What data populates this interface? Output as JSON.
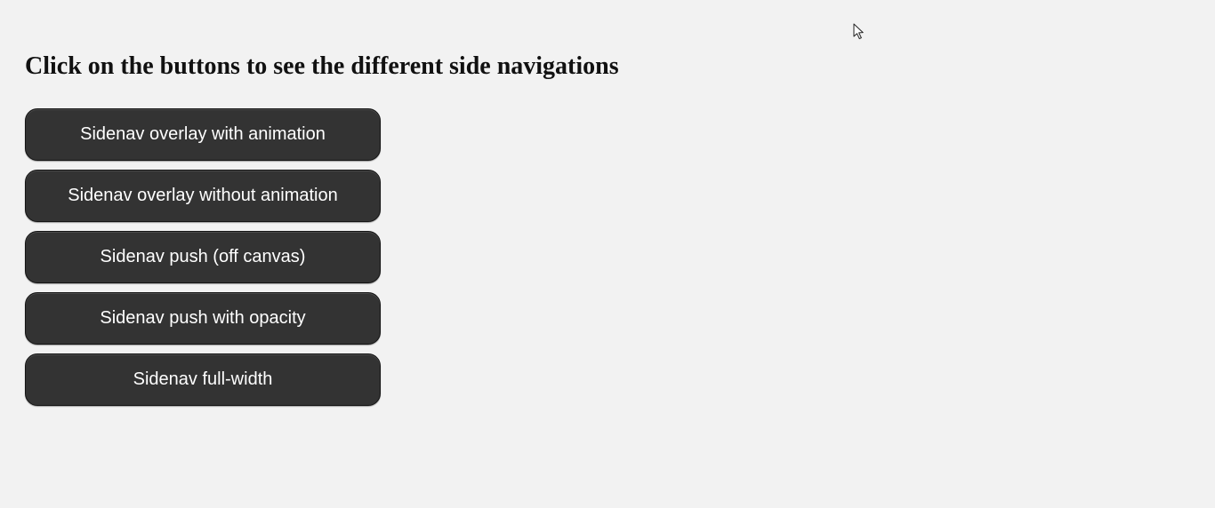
{
  "page": {
    "title": "Click on the buttons to see the different side navigations"
  },
  "buttons": [
    {
      "label": "Sidenav overlay with animation"
    },
    {
      "label": "Sidenav overlay without animation"
    },
    {
      "label": "Sidenav push (off canvas)"
    },
    {
      "label": "Sidenav push with opacity"
    },
    {
      "label": "Sidenav full-width"
    }
  ],
  "colors": {
    "background": "#f2f2f2",
    "button_bg": "#333333",
    "button_text": "#ffffff",
    "title_text": "#111111"
  },
  "icons": {
    "cursor": "mouse-pointer-icon"
  }
}
